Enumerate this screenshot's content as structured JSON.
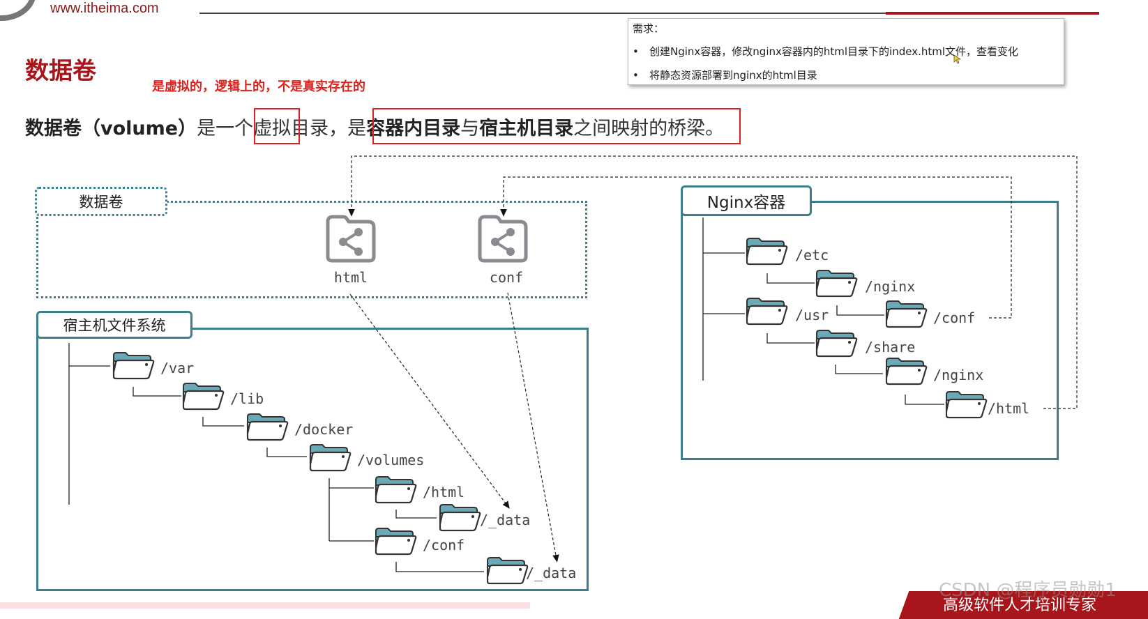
{
  "header": {
    "site_url": "www.itheima.com"
  },
  "title": "数据卷",
  "annotation": "是虚拟的，逻辑上的，不是真实存在的",
  "requirements": {
    "title": "需求：",
    "items": [
      "创建Nginx容器，修改nginx容器内的html目录下的index.html文件，查看变化",
      "将静态资源部署到nginx的html目录"
    ]
  },
  "definition": {
    "part1": "数据卷（volume）",
    "part2": "是一个",
    "part3": "虚拟",
    "part4": "目录，是",
    "part5": "容器内目录",
    "part6": "与",
    "part7": "宿主机目录",
    "part8": "之间映射的桥梁",
    "part9": "。"
  },
  "diagram": {
    "volume_label": "数据卷",
    "volumes": [
      "html",
      "conf"
    ],
    "host_label": "宿主机文件系统",
    "host_paths": [
      "/var",
      "/lib",
      "/docker",
      "/volumes",
      "/html",
      "/_data",
      "/conf",
      "/_data"
    ],
    "container_label": "Nginx容器",
    "container_paths": [
      "/etc",
      "/nginx",
      "/usr",
      "/conf",
      "/share",
      "/nginx",
      "/html"
    ]
  },
  "colors": {
    "teal": "#3d7e8c",
    "folder": "#6aa9b8",
    "brand_red": "#a8151b",
    "highlight_red": "#e41c1c"
  },
  "watermark": "CSDN @程序员勋勋1",
  "banner": "高级软件人才培训专家"
}
